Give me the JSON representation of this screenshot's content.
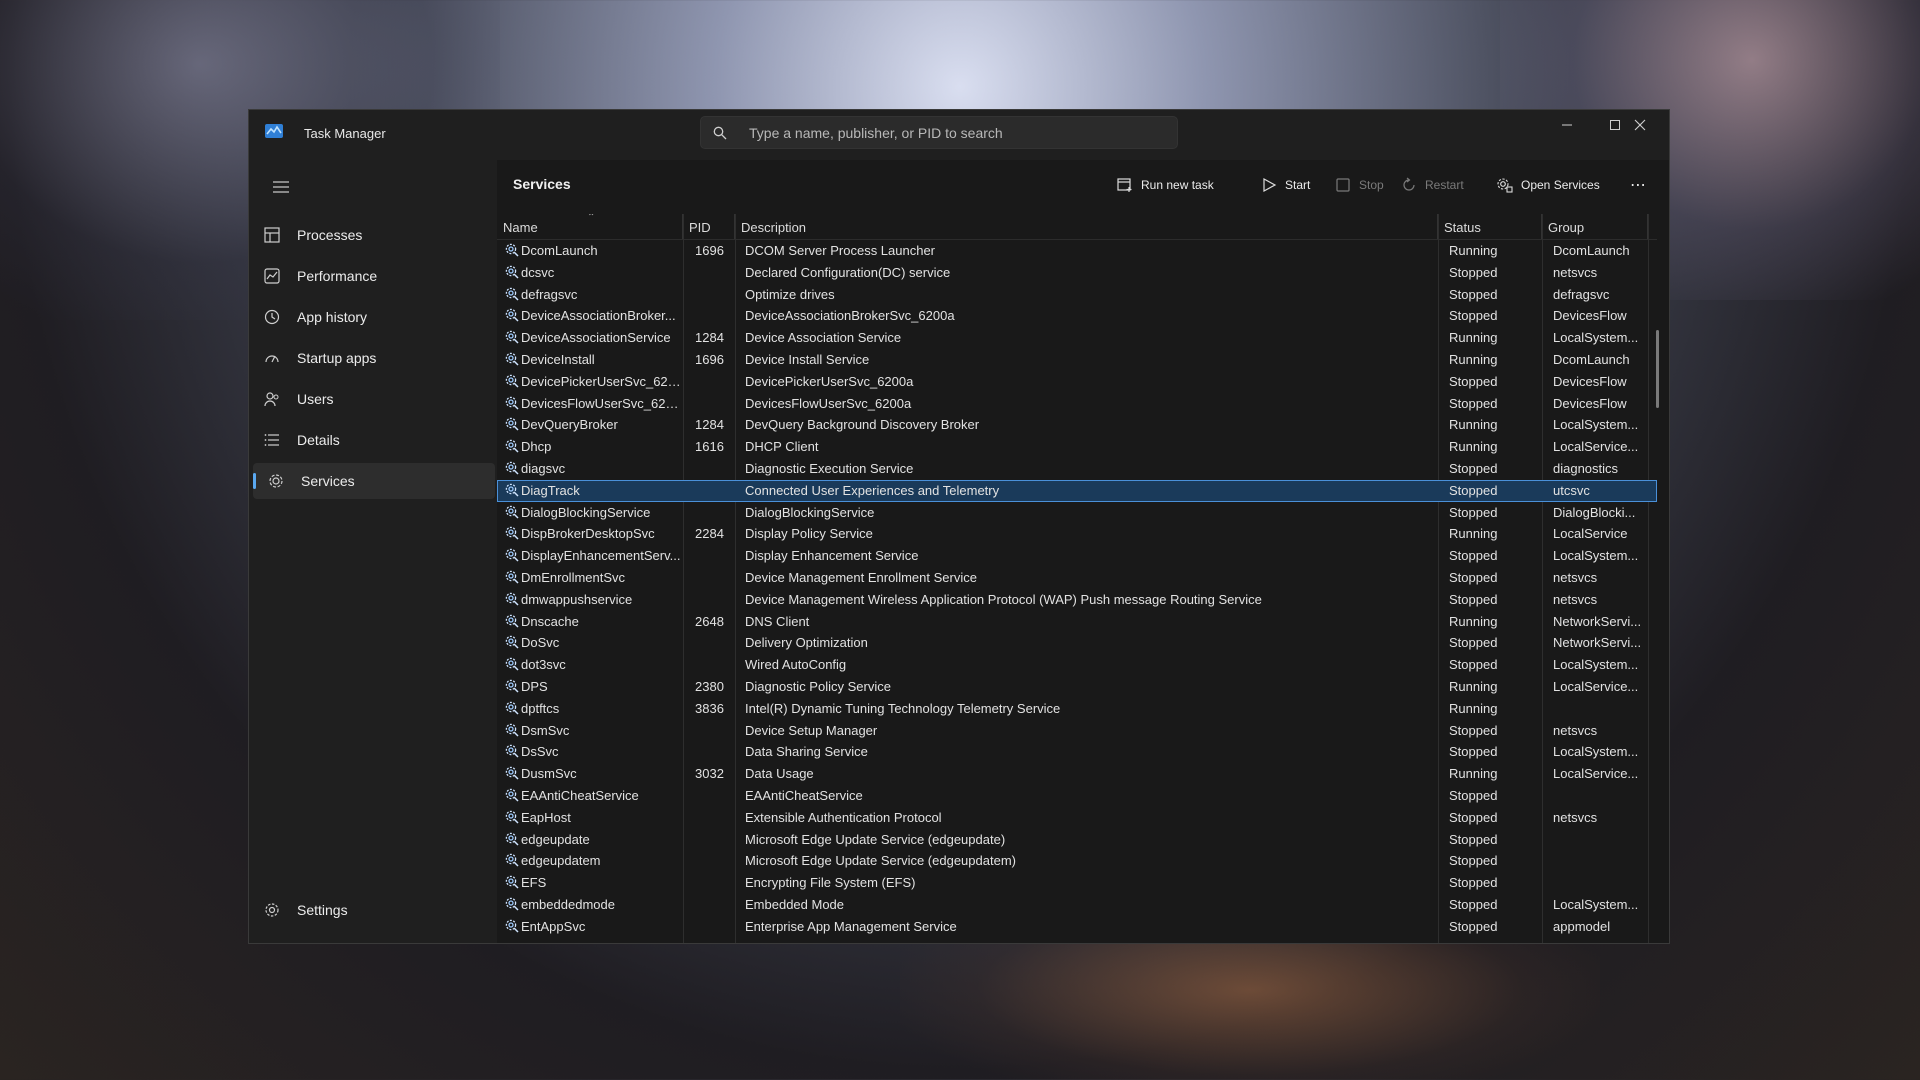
{
  "window": {
    "title": "Task Manager",
    "search_placeholder": "Type a name, publisher, or PID to search"
  },
  "sidebar": {
    "items": [
      {
        "label": "Processes",
        "icon": "processes-icon"
      },
      {
        "label": "Performance",
        "icon": "performance-icon"
      },
      {
        "label": "App history",
        "icon": "app-history-icon"
      },
      {
        "label": "Startup apps",
        "icon": "startup-apps-icon"
      },
      {
        "label": "Users",
        "icon": "users-icon"
      },
      {
        "label": "Details",
        "icon": "details-icon"
      },
      {
        "label": "Services",
        "icon": "services-icon",
        "active": true
      }
    ],
    "settings_label": "Settings"
  },
  "toolbar": {
    "page_title": "Services",
    "run_new_task": "Run new task",
    "start": "Start",
    "stop": "Stop",
    "restart": "Restart",
    "open_services": "Open Services",
    "more": "⋯"
  },
  "columns": {
    "name": "Name",
    "pid": "PID",
    "description": "Description",
    "status": "Status",
    "group": "Group"
  },
  "accent": "#5aa8f0",
  "selected_row_index": 11,
  "rows": [
    {
      "name": "DcomLaunch",
      "pid": "1696",
      "desc": "DCOM Server Process Launcher",
      "status": "Running",
      "group": "DcomLaunch"
    },
    {
      "name": "dcsvc",
      "pid": "",
      "desc": "Declared Configuration(DC) service",
      "status": "Stopped",
      "group": "netsvcs"
    },
    {
      "name": "defragsvc",
      "pid": "",
      "desc": "Optimize drives",
      "status": "Stopped",
      "group": "defragsvc"
    },
    {
      "name": "DeviceAssociationBroker...",
      "pid": "",
      "desc": "DeviceAssociationBrokerSvc_6200a",
      "status": "Stopped",
      "group": "DevicesFlow"
    },
    {
      "name": "DeviceAssociationService",
      "pid": "1284",
      "desc": "Device Association Service",
      "status": "Running",
      "group": "LocalSystem..."
    },
    {
      "name": "DeviceInstall",
      "pid": "1696",
      "desc": "Device Install Service",
      "status": "Running",
      "group": "DcomLaunch"
    },
    {
      "name": "DevicePickerUserSvc_620...",
      "pid": "",
      "desc": "DevicePickerUserSvc_6200a",
      "status": "Stopped",
      "group": "DevicesFlow"
    },
    {
      "name": "DevicesFlowUserSvc_620...",
      "pid": "",
      "desc": "DevicesFlowUserSvc_6200a",
      "status": "Stopped",
      "group": "DevicesFlow"
    },
    {
      "name": "DevQueryBroker",
      "pid": "1284",
      "desc": "DevQuery Background Discovery Broker",
      "status": "Running",
      "group": "LocalSystem..."
    },
    {
      "name": "Dhcp",
      "pid": "1616",
      "desc": "DHCP Client",
      "status": "Running",
      "group": "LocalService..."
    },
    {
      "name": "diagsvc",
      "pid": "",
      "desc": "Diagnostic Execution Service",
      "status": "Stopped",
      "group": "diagnostics"
    },
    {
      "name": "DiagTrack",
      "pid": "",
      "desc": "Connected User Experiences and Telemetry",
      "status": "Stopped",
      "group": "utcsvc"
    },
    {
      "name": "DialogBlockingService",
      "pid": "",
      "desc": "DialogBlockingService",
      "status": "Stopped",
      "group": "DialogBlocki..."
    },
    {
      "name": "DispBrokerDesktopSvc",
      "pid": "2284",
      "desc": "Display Policy Service",
      "status": "Running",
      "group": "LocalService"
    },
    {
      "name": "DisplayEnhancementServ...",
      "pid": "",
      "desc": "Display Enhancement Service",
      "status": "Stopped",
      "group": "LocalSystem..."
    },
    {
      "name": "DmEnrollmentSvc",
      "pid": "",
      "desc": "Device Management Enrollment Service",
      "status": "Stopped",
      "group": "netsvcs"
    },
    {
      "name": "dmwappushservice",
      "pid": "",
      "desc": "Device Management Wireless Application Protocol (WAP) Push message Routing Service",
      "status": "Stopped",
      "group": "netsvcs"
    },
    {
      "name": "Dnscache",
      "pid": "2648",
      "desc": "DNS Client",
      "status": "Running",
      "group": "NetworkServi..."
    },
    {
      "name": "DoSvc",
      "pid": "",
      "desc": "Delivery Optimization",
      "status": "Stopped",
      "group": "NetworkServi..."
    },
    {
      "name": "dot3svc",
      "pid": "",
      "desc": "Wired AutoConfig",
      "status": "Stopped",
      "group": "LocalSystem..."
    },
    {
      "name": "DPS",
      "pid": "2380",
      "desc": "Diagnostic Policy Service",
      "status": "Running",
      "group": "LocalService..."
    },
    {
      "name": "dptftcs",
      "pid": "3836",
      "desc": "Intel(R) Dynamic Tuning Technology Telemetry Service",
      "status": "Running",
      "group": ""
    },
    {
      "name": "DsmSvc",
      "pid": "",
      "desc": "Device Setup Manager",
      "status": "Stopped",
      "group": "netsvcs"
    },
    {
      "name": "DsSvc",
      "pid": "",
      "desc": "Data Sharing Service",
      "status": "Stopped",
      "group": "LocalSystem..."
    },
    {
      "name": "DusmSvc",
      "pid": "3032",
      "desc": "Data Usage",
      "status": "Running",
      "group": "LocalService..."
    },
    {
      "name": "EAAntiCheatService",
      "pid": "",
      "desc": "EAAntiCheatService",
      "status": "Stopped",
      "group": ""
    },
    {
      "name": "EapHost",
      "pid": "",
      "desc": "Extensible Authentication Protocol",
      "status": "Stopped",
      "group": "netsvcs"
    },
    {
      "name": "edgeupdate",
      "pid": "",
      "desc": "Microsoft Edge Update Service (edgeupdate)",
      "status": "Stopped",
      "group": ""
    },
    {
      "name": "edgeupdatem",
      "pid": "",
      "desc": "Microsoft Edge Update Service (edgeupdatem)",
      "status": "Stopped",
      "group": ""
    },
    {
      "name": "EFS",
      "pid": "",
      "desc": "Encrypting File System (EFS)",
      "status": "Stopped",
      "group": ""
    },
    {
      "name": "embeddedmode",
      "pid": "",
      "desc": "Embedded Mode",
      "status": "Stopped",
      "group": "LocalSystem..."
    },
    {
      "name": "EntAppSvc",
      "pid": "",
      "desc": "Enterprise App Management Service",
      "status": "Stopped",
      "group": "appmodel"
    }
  ]
}
